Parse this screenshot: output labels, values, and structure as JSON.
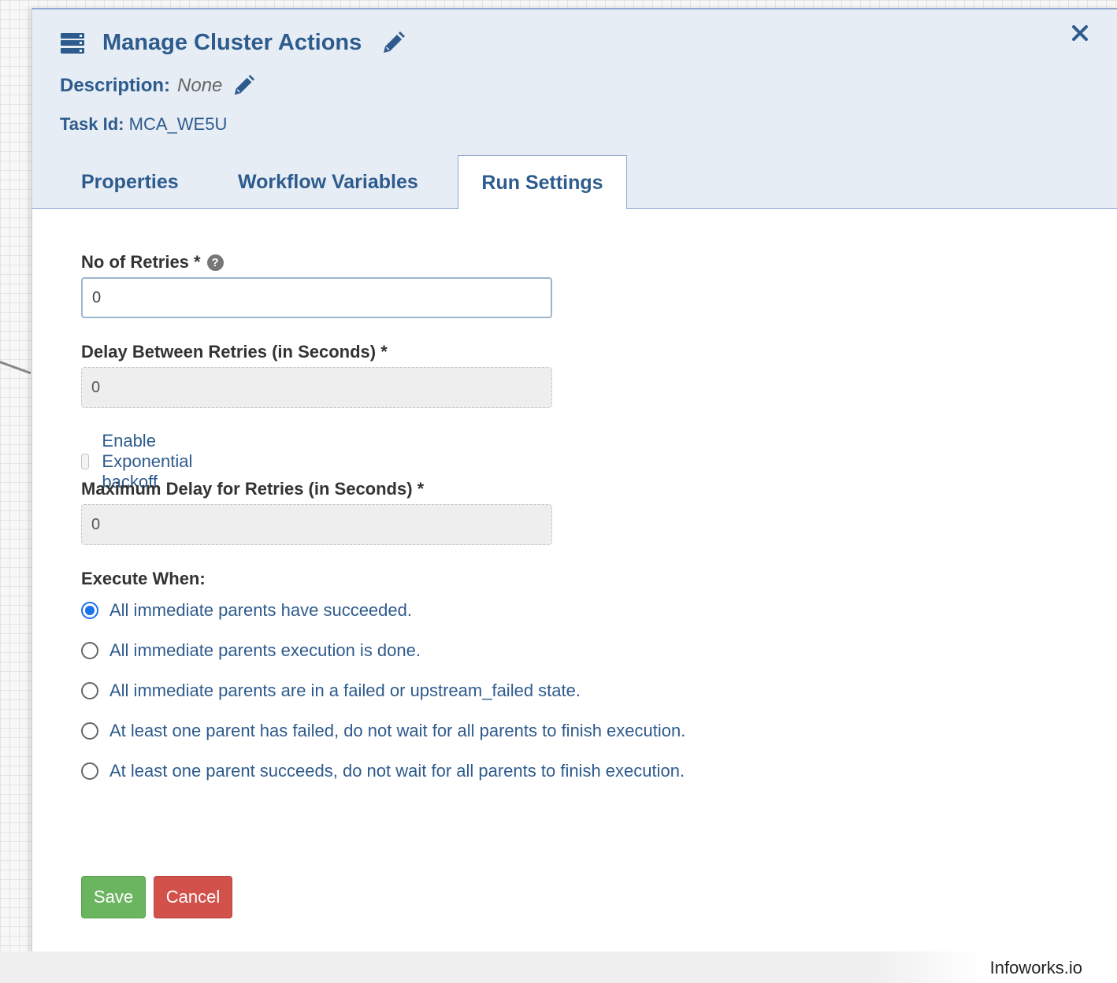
{
  "header": {
    "title": "Manage Cluster Actions",
    "description_label": "Description:",
    "description_value": "None",
    "task_id_label": "Task Id:",
    "task_id_value": "MCA_WE5U"
  },
  "tabs": [
    {
      "label": "Properties",
      "active": false
    },
    {
      "label": "Workflow Variables",
      "active": false
    },
    {
      "label": "Run Settings",
      "active": true
    }
  ],
  "form": {
    "retries": {
      "label": "No of Retries *",
      "value": "0"
    },
    "delay": {
      "label": "Delay Between Retries (in Seconds) *",
      "value": "0"
    },
    "exponential_backoff": {
      "label": "Enable Exponential backoff",
      "checked": false
    },
    "max_delay": {
      "label": "Maximum Delay for Retries (in Seconds) *",
      "value": "0"
    },
    "execute_when": {
      "label": "Execute When:",
      "options": [
        {
          "label": "All immediate parents have succeeded.",
          "selected": true
        },
        {
          "label": "All immediate parents execution is done.",
          "selected": false
        },
        {
          "label": "All immediate parents are in a failed or upstream_failed state.",
          "selected": false
        },
        {
          "label": "At least one parent has failed, do not wait for all parents to finish execution.",
          "selected": false
        },
        {
          "label": "At least one parent succeeds, do not wait for all parents to finish execution.",
          "selected": false
        }
      ]
    }
  },
  "buttons": {
    "save": "Save",
    "cancel": "Cancel"
  },
  "footer": {
    "brand": "Infoworks.io"
  },
  "colors": {
    "accent": "#2e5b8d",
    "save": "#6cb560",
    "cancel": "#d2514a",
    "radio_selected": "#1a73e8"
  },
  "icons": {
    "title": "server-icon",
    "edit": "pencil-icon",
    "close": "close-icon",
    "help": "question-circle-icon"
  }
}
